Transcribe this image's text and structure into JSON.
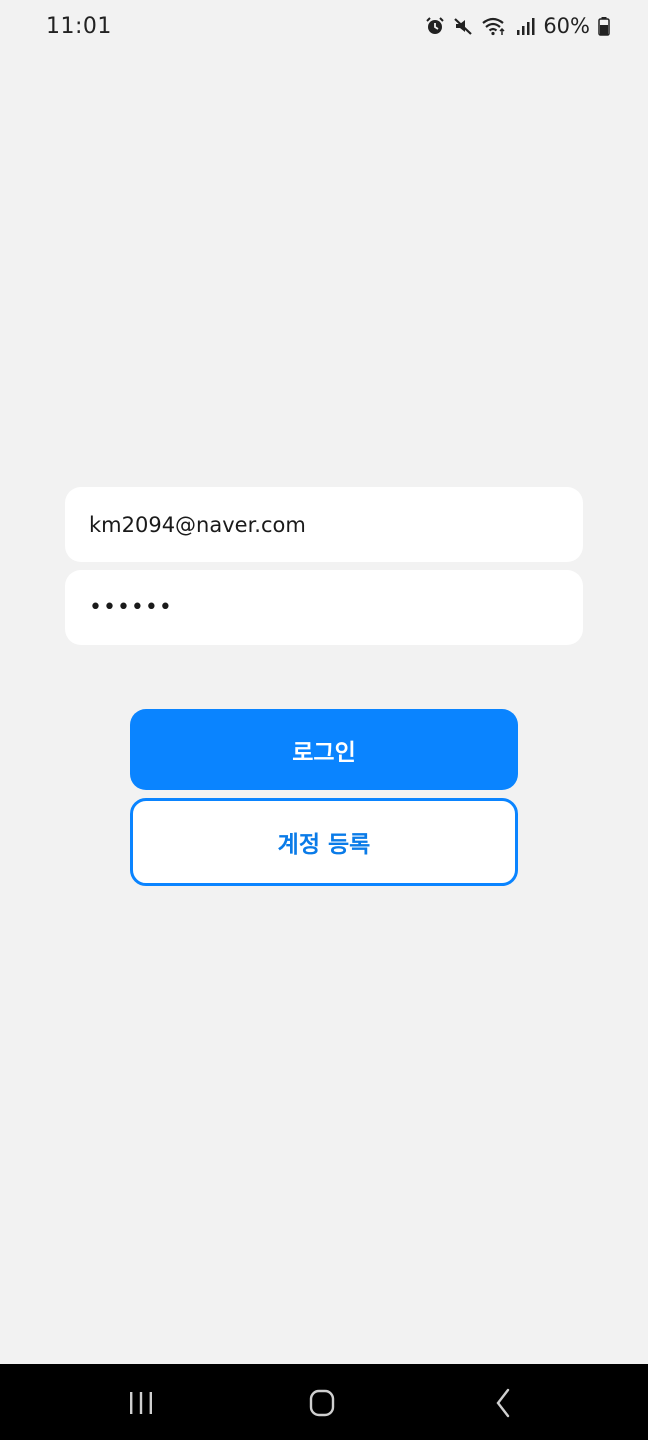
{
  "status_bar": {
    "time": "11:01",
    "battery": "60%",
    "icons": [
      "alarm-icon",
      "mute-icon",
      "wifi-icon",
      "signal-icon",
      "battery-icon"
    ]
  },
  "login_form": {
    "email_value": "km2094@naver.com",
    "password_value": "••••••"
  },
  "buttons": {
    "login_label": "로그인",
    "register_label": "계정 등록"
  },
  "nav": {
    "icons": [
      "recents-icon",
      "home-icon",
      "back-icon"
    ]
  },
  "colors": {
    "background": "#f2f2f2",
    "accent": "#0a84ff",
    "input_bg": "#ffffff",
    "nav_bg": "#000000"
  }
}
